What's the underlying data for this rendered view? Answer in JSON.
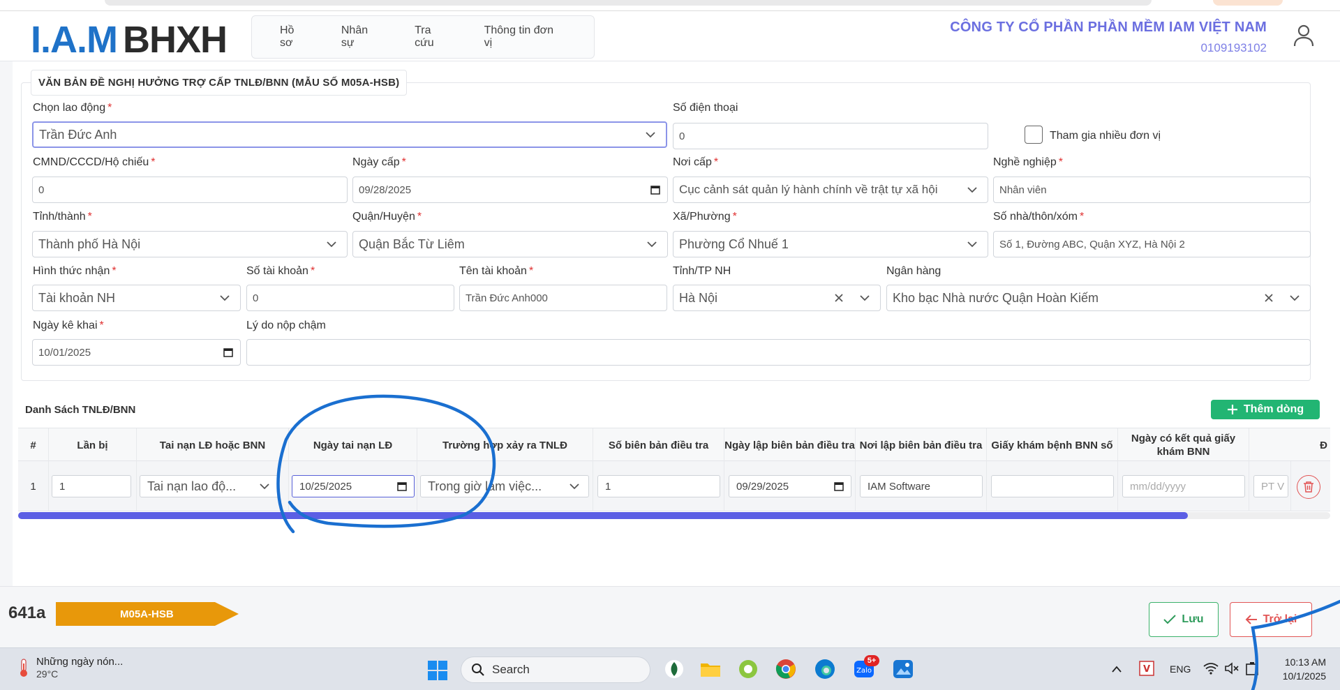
{
  "header": {
    "logo_iam": "I.A.M",
    "logo_bhxh": "BHXH",
    "nav": [
      "Hồ sơ",
      "Nhân sự",
      "Tra cứu",
      "Thông tin đơn vị"
    ],
    "company_name": "CÔNG TY CỔ PHẦN PHẦN MỀM IAM VIỆT NAM",
    "company_tax": "0109193102"
  },
  "form": {
    "legend": "VĂN BẢN ĐỀ NGHỊ HƯỞNG TRỢ CẤP TNLĐ/BNN (MẪU SỐ M05A-HSB)",
    "employee": {
      "label": "Chọn lao động",
      "value": "Trần Đức Anh"
    },
    "phone": {
      "label": "Số điện thoại",
      "value": "0"
    },
    "multi_unit": {
      "label": "Tham gia nhiều đơn vị"
    },
    "id_number": {
      "label": "CMND/CCCD/Hộ chiếu",
      "value": "0"
    },
    "issue_date": {
      "label": "Ngày cấp",
      "value": "09/28/2025"
    },
    "issue_place": {
      "label": "Nơi cấp",
      "value": "Cục cảnh sát quản lý hành chính về trật tự xã hội"
    },
    "occupation": {
      "label": "Nghề nghiệp",
      "value": "Nhân viên"
    },
    "province": {
      "label": "Tỉnh/thành",
      "value": "Thành phố Hà Nội"
    },
    "district": {
      "label": "Quận/Huyện",
      "value": "Quận Bắc Từ Liêm"
    },
    "ward": {
      "label": "Xã/Phường",
      "value": "Phường Cổ Nhuế 1"
    },
    "address": {
      "label": "Số nhà/thôn/xóm",
      "value": "Số 1, Đường ABC, Quận XYZ, Hà Nội 2"
    },
    "receive_method": {
      "label": "Hình thức nhận",
      "value": "Tài khoản NH"
    },
    "account_no": {
      "label": "Số tài khoản",
      "value": "0"
    },
    "account_name": {
      "label": "Tên tài khoản",
      "value": "Trần Đức Anh000"
    },
    "bank_province": {
      "label": "Tỉnh/TP NH",
      "value": "Hà Nội"
    },
    "bank": {
      "label": "Ngân hàng",
      "value": "Kho bạc Nhà nước Quận Hoàn Kiếm"
    },
    "declare_date": {
      "label": "Ngày kê khai",
      "value": "10/01/2025"
    },
    "late_reason": {
      "label": "Lý do nộp chậm",
      "value": ""
    }
  },
  "table": {
    "title": "Danh Sách TNLĐ/BNN",
    "add_label": "Thêm dòng",
    "headers": [
      "#",
      "Lần bị",
      "Tai nạn LĐ hoặc BNN",
      "Ngày tai nạn LĐ",
      "Trường hợp xảy ra TNLĐ",
      "Số biên bản điều tra",
      "Ngày lập biên bản điều tra",
      "Nơi lập biên bản điều tra",
      "Giấy khám bệnh BNN số",
      "Ngày có kết quả giấy khám BNN",
      "Đ"
    ],
    "rows": [
      {
        "index": "1",
        "times": "1",
        "type": "Tai nạn lao độ...",
        "accident_date": "10/25/2025",
        "case": "Trong giờ làm việc...",
        "report_no": "1",
        "report_date": "09/29/2025",
        "report_place": "IAM Software",
        "bnn_paper": "",
        "bnn_date_placeholder": "mm/dd/yyyy",
        "extra": "PT V"
      }
    ]
  },
  "footer": {
    "code": "641a",
    "form_tag": "M05A-HSB",
    "save_label": "Lưu",
    "back_label": "Trở lại"
  },
  "taskbar": {
    "weather_text": "Những ngày nón...",
    "weather_temp": "29°C",
    "search_label": "Search",
    "lang": "ENG",
    "time": "10:13 AM",
    "date": "10/1/2025",
    "zalo_badge": "5+"
  },
  "colors": {
    "brand_blue": "#1f72c8",
    "company_purple": "#6b6fe0",
    "accent_green": "#22b573",
    "danger_red": "#e25555",
    "tag_orange": "#e8980a",
    "scroll_indigo": "#5b5ee4",
    "annotation_blue": "#1a6fd0"
  }
}
